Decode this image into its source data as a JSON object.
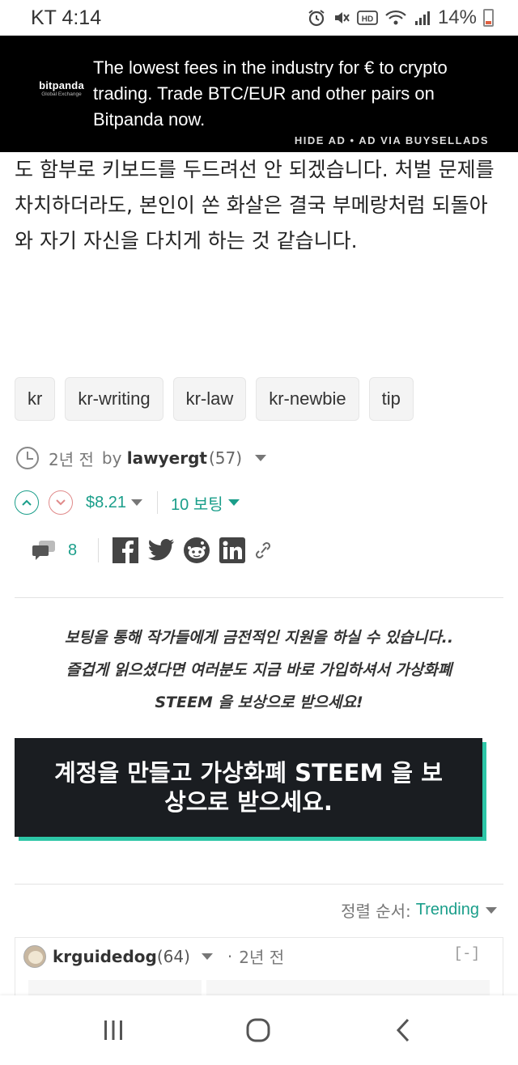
{
  "status_bar": {
    "carrier_time": "KT 4:14",
    "battery": "14%"
  },
  "ad": {
    "brand": "bitpanda",
    "brand_sub": "Global Exchange",
    "text": "The lowest fees in the industry for € to crypto trading. Trade BTC/EUR and other pairs on Bitpanda now.",
    "hide": "HIDE AD",
    "separator": "•",
    "via": "AD VIA BUYSELLADS"
  },
  "article": {
    "text": "도 함부로 키보드를 두드려선 안 되겠습니다. 처벌 문제를 차치하더라도, 본인이 쏜 화살은 결국 부메랑처럼 되돌아와 자기 자신을 다치게 하는 것 같습니다."
  },
  "tags": [
    "kr",
    "kr-writing",
    "kr-law",
    "kr-newbie",
    "tip"
  ],
  "meta": {
    "time": "2년 전",
    "by": "by",
    "author": "lawyergt",
    "reputation": "(57)"
  },
  "votes": {
    "payout": "$8.21",
    "count": "10 보팅"
  },
  "comments": {
    "count": "8"
  },
  "promo": {
    "line1": "보팅을 통해 작가들에게 금전적인 지원을 하실 수 있습니다..",
    "line2": "즐겁게 읽으셨다면 여러분도 지금 바로 가입하셔서 가상화폐",
    "line3": "STEEM 을 보상으로 받으세요!"
  },
  "cta": {
    "label": "계정을 만들고 가상화폐 STEEM 을 보상으로 받으세요."
  },
  "sort": {
    "label": "정렬 순서:",
    "value": "Trending"
  },
  "comment": {
    "user": "krguidedog",
    "reputation": "(64)",
    "separator": "·",
    "time": "2년 전",
    "collapse": "[-]"
  },
  "colors": {
    "accent": "#1a9e8a",
    "cta_bg": "#1a1d21",
    "cta_shadow": "#2dc6a7",
    "ad_bg": "#000000"
  }
}
